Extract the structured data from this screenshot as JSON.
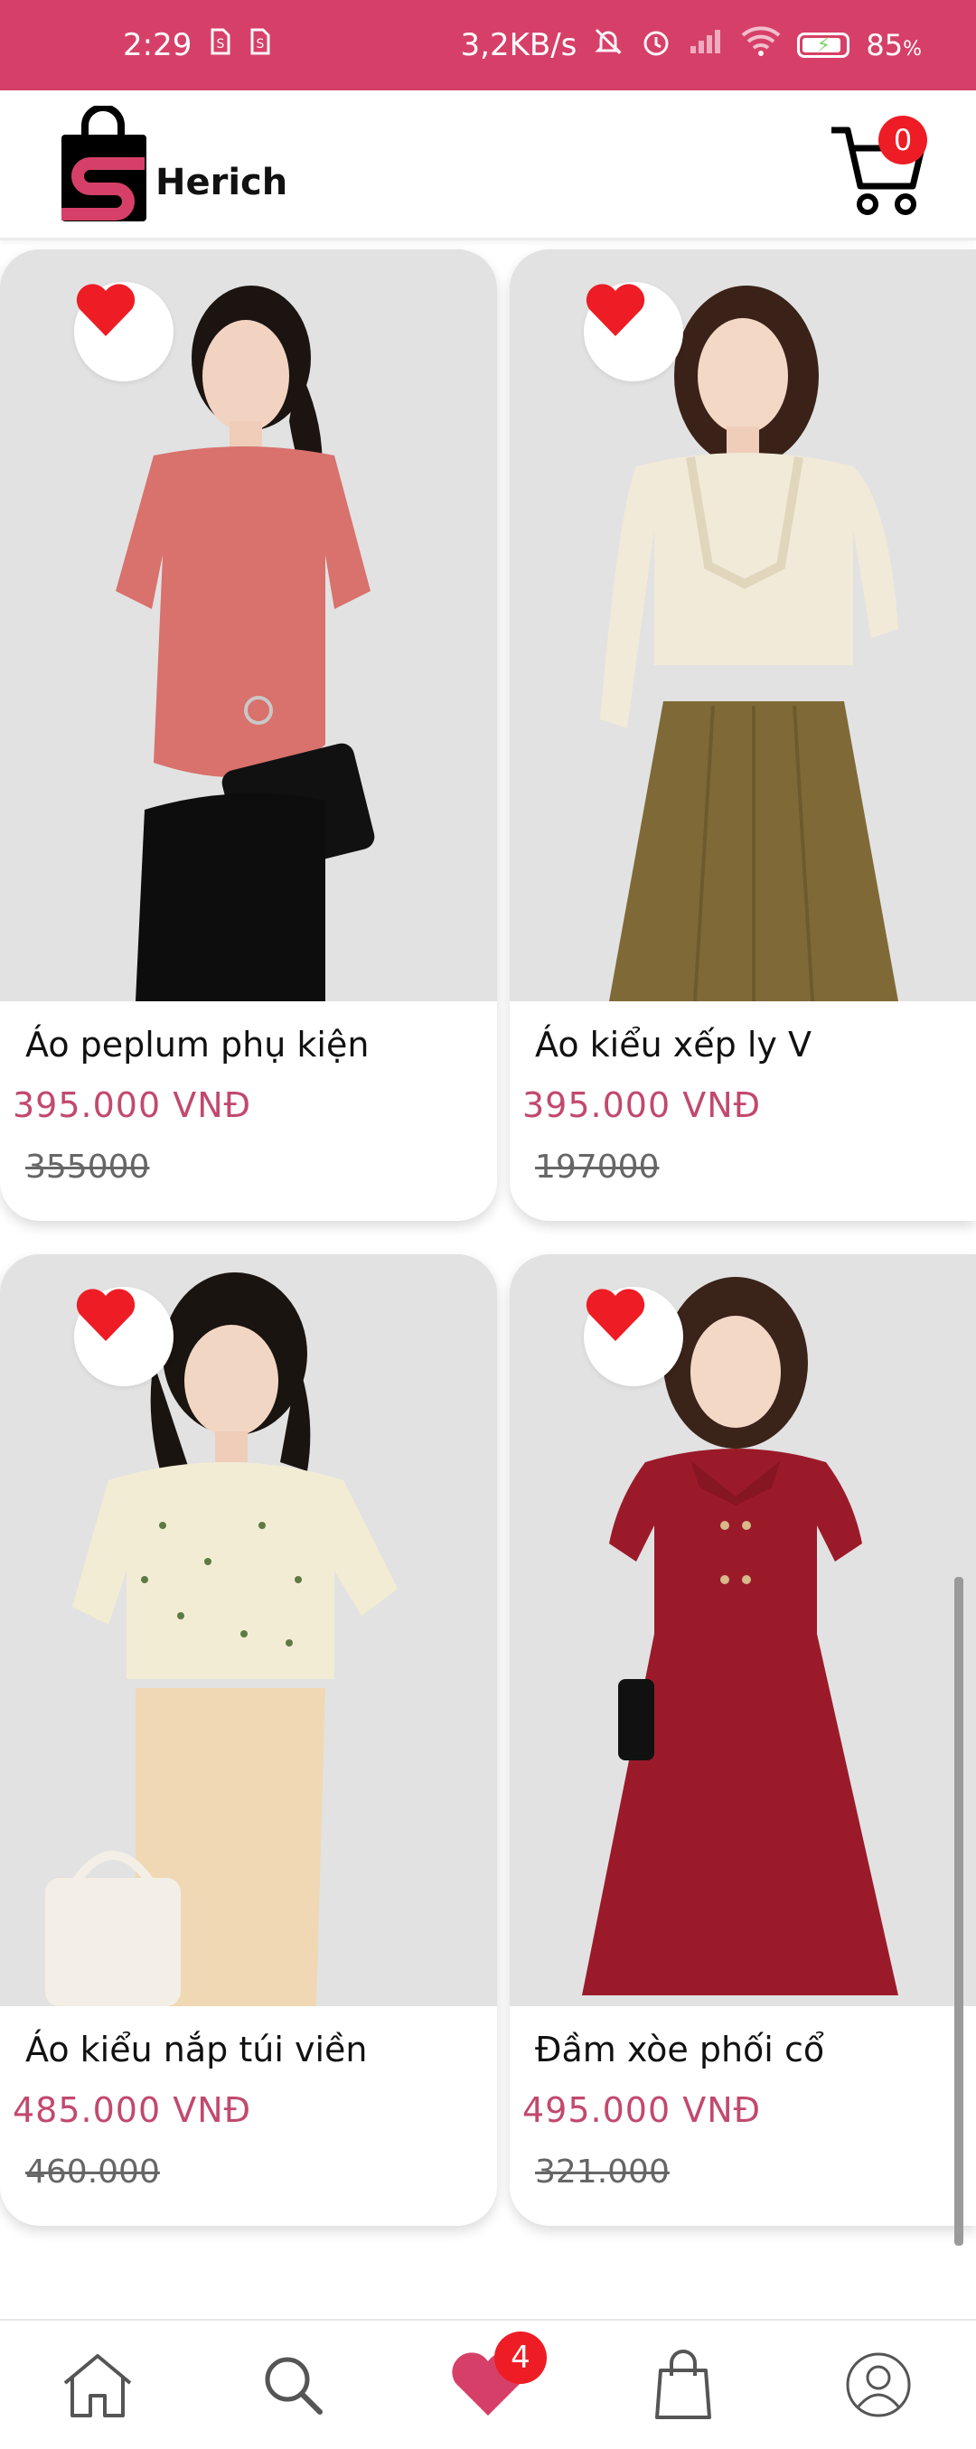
{
  "status_bar": {
    "time": "2:29",
    "network_speed": "3,2KB/s",
    "battery": "85",
    "battery_unit": "%",
    "icons": [
      "sim-icon",
      "sim-icon",
      "mute-bell-icon",
      "alarm-icon",
      "signal-icon",
      "wifi-icon",
      "battery-charging-icon"
    ]
  },
  "header": {
    "logo_text": "Herich",
    "cart_count": "0"
  },
  "colors": {
    "accent": "#d64068",
    "price": "#c2496e",
    "badge": "#ee1c25",
    "heart": "#ee1c25",
    "nav_heart": "#d64068"
  },
  "products": [
    {
      "name": "Áo peplum phụ kiện",
      "price": "395.000 VNĐ",
      "old_price": "355000",
      "favorite": true
    },
    {
      "name": "Áo kiểu xếp ly V",
      "price": "395.000 VNĐ",
      "old_price": "197000",
      "favorite": true
    },
    {
      "name": "Áo kiểu nắp túi viền",
      "price": "485.000 VNĐ",
      "old_price": "460.000",
      "favorite": true
    },
    {
      "name": "Đầm xòe phối cổ",
      "price": "495.000 VNĐ",
      "old_price": "321.000",
      "favorite": true
    }
  ],
  "bottom_nav": {
    "items": [
      "home-icon",
      "search-icon",
      "favorites-icon",
      "bag-icon",
      "profile-icon"
    ],
    "active": "favorites-icon",
    "favorites_count": "4"
  }
}
